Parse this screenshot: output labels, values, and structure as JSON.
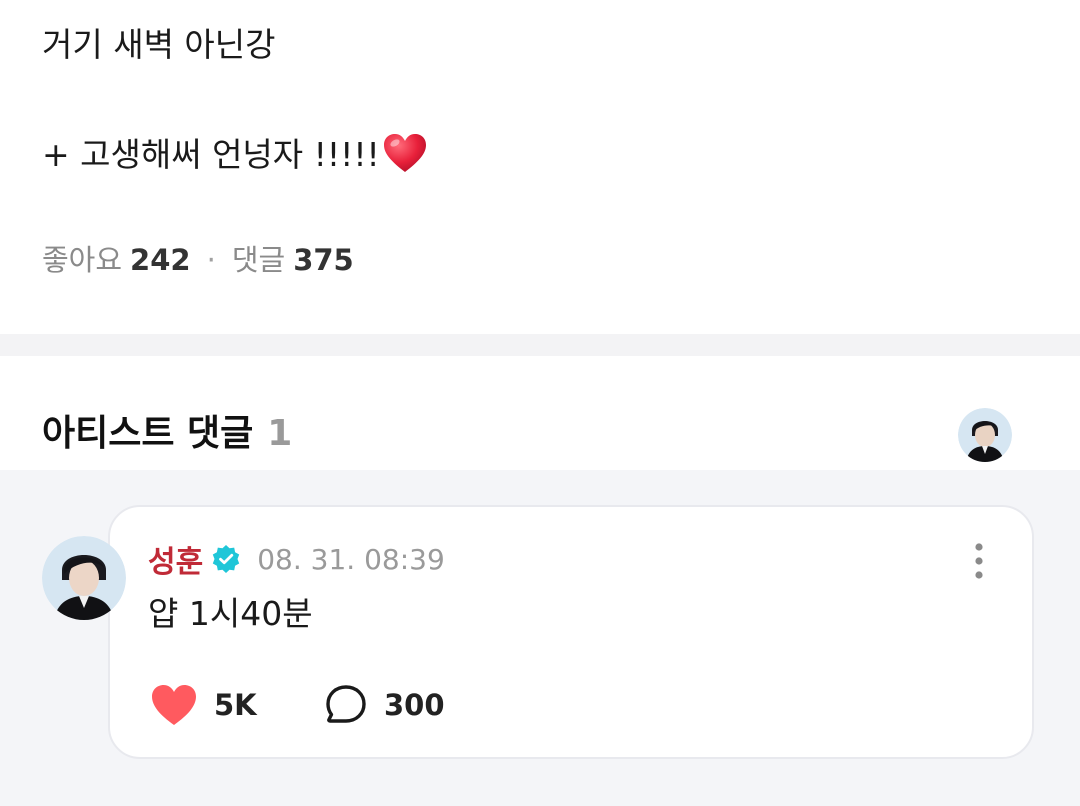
{
  "post": {
    "text_line1": "거기 새벽 아닌강",
    "text_line2": "+ 고생해써 언넝자 !!!!!",
    "emoji": "heart-emoji"
  },
  "stats": {
    "likes_label": "좋아요",
    "likes_count": "242",
    "separator": "·",
    "comments_label": "댓글",
    "comments_count": "375"
  },
  "artist_section": {
    "title": "아티스트 댓글",
    "count": "1"
  },
  "comment": {
    "author": "성훈",
    "verified": true,
    "timestamp": "08. 31. 08:39",
    "text": "얍 1시40분",
    "like_count": "5K",
    "reply_count": "300"
  },
  "colors": {
    "author": "#c02a37",
    "verified_badge": "#1fc6d8",
    "like_heart": "#ff5a5f",
    "divider": "#f3f3f5",
    "comment_area_bg": "#f4f5f8"
  }
}
